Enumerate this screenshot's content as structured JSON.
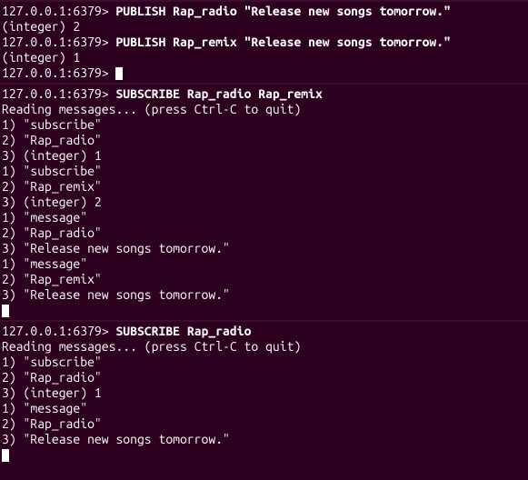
{
  "prompt": "127.0.0.1:6379> ",
  "pane1": {
    "cmd1": "PUBLISH Rap_radio \"Release new songs tomorrow.\"",
    "out1": "(integer) 2",
    "cmd2": "PUBLISH Rap_remix \"Release new songs tomorrow.\"",
    "out2": "(integer) 1"
  },
  "pane2": {
    "cmd": "SUBSCRIBE Rap_radio Rap_remix",
    "reading": "Reading messages... (press Ctrl-C to quit)",
    "l1": "1) \"subscribe\"",
    "l2": "2) \"Rap_radio\"",
    "l3": "3) (integer) 1",
    "l4": "1) \"subscribe\"",
    "l5": "2) \"Rap_remix\"",
    "l6": "3) (integer) 2",
    "l7": "1) \"message\"",
    "l8": "2) \"Rap_radio\"",
    "l9": "3) \"Release new songs tomorrow.\"",
    "l10": "1) \"message\"",
    "l11": "2) \"Rap_remix\"",
    "l12": "3) \"Release new songs tomorrow.\""
  },
  "pane3": {
    "cmd": "SUBSCRIBE Rap_radio",
    "reading": "Reading messages... (press Ctrl-C to quit)",
    "l1": "1) \"subscribe\"",
    "l2": "2) \"Rap_radio\"",
    "l3": "3) (integer) 1",
    "l4": "1) \"message\"",
    "l5": "2) \"Rap_radio\"",
    "l6": "3) \"Release new songs tomorrow.\""
  }
}
